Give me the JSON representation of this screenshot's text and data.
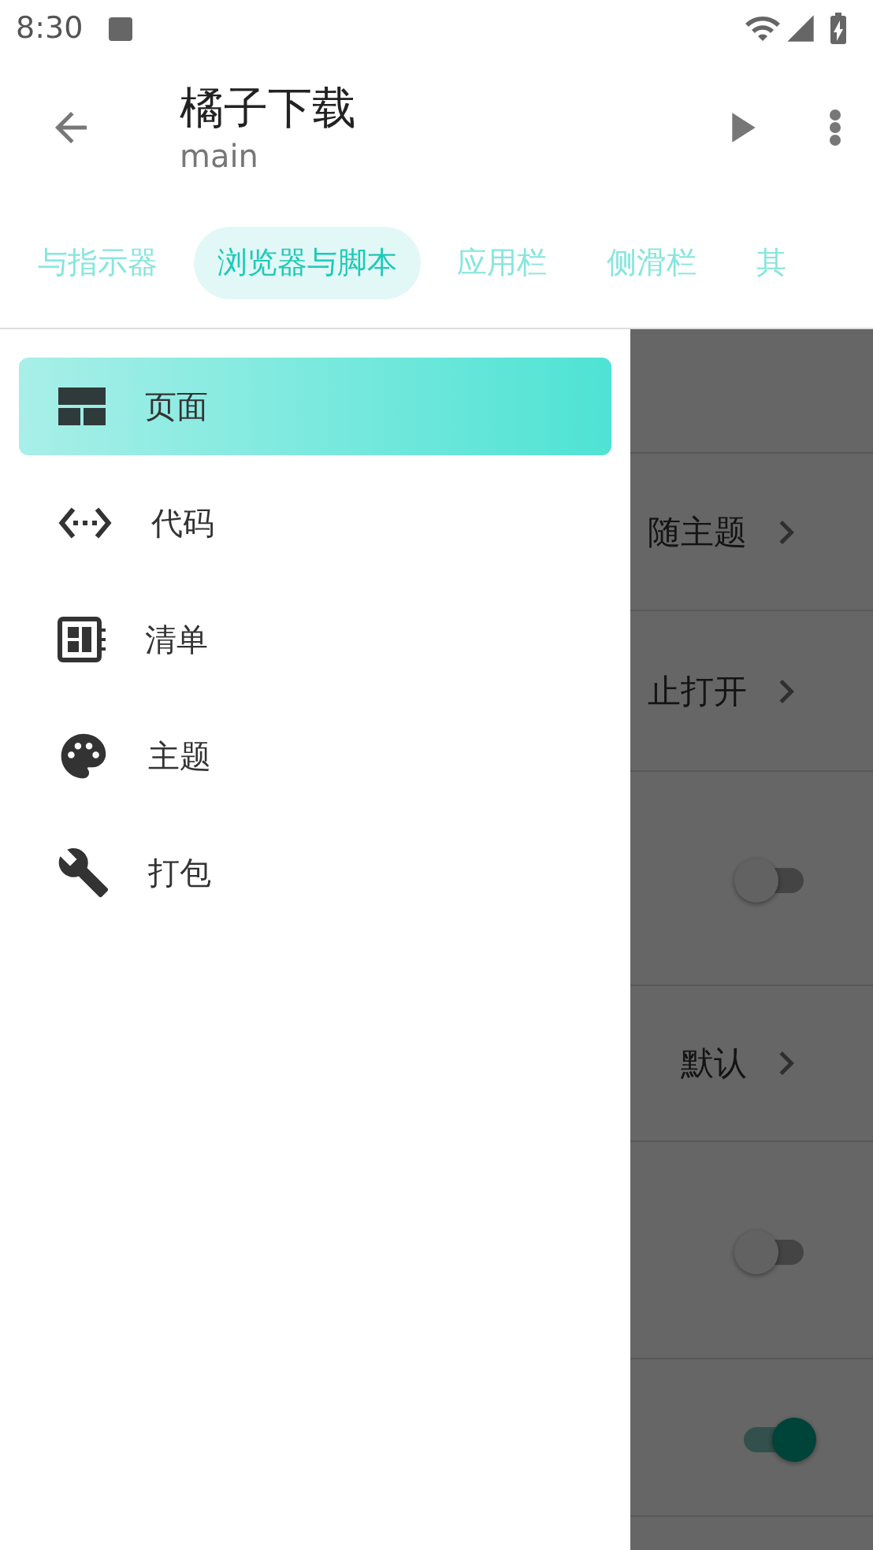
{
  "status_bar": {
    "time": "8:30"
  },
  "app_bar": {
    "title": "橘子下载",
    "subtitle": "main"
  },
  "tabs": [
    {
      "label": "与指示器",
      "selected": false
    },
    {
      "label": "浏览器与脚本",
      "selected": true
    },
    {
      "label": "应用栏",
      "selected": false
    },
    {
      "label": "侧滑栏",
      "selected": false
    },
    {
      "label": "其",
      "selected": false
    }
  ],
  "settings": [
    {
      "kind": "blank"
    },
    {
      "kind": "link",
      "value": "随主题"
    },
    {
      "kind": "link",
      "value": "止打开"
    },
    {
      "kind": "switch",
      "on": false
    },
    {
      "kind": "link",
      "value": "默认"
    },
    {
      "kind": "switch",
      "on": false
    },
    {
      "kind": "switch",
      "on": true
    }
  ],
  "drawer": {
    "items": [
      {
        "kind": "page",
        "label": "页面",
        "selected": true
      },
      {
        "kind": "code",
        "label": "代码",
        "selected": false
      },
      {
        "kind": "manifest",
        "label": "清单",
        "selected": false
      },
      {
        "kind": "theme",
        "label": "主题",
        "selected": false
      },
      {
        "kind": "build",
        "label": "打包",
        "selected": false
      }
    ]
  }
}
